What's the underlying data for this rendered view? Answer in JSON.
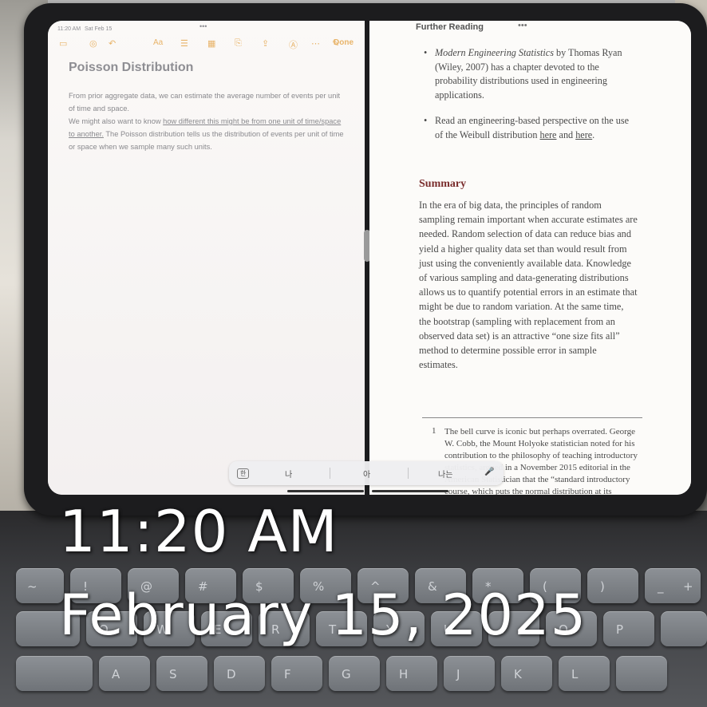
{
  "status_bar": {
    "time": "11:20 AM",
    "date": "Sat Feb 15"
  },
  "notes": {
    "done_label": "Done",
    "title": "Poisson Distribution",
    "line1": "From prior aggregate data, we can estimate the average number of events per unit of time and space.",
    "line2_prefix": "We might also want to know ",
    "line2_link": "how different this might be from one unit of time/space to another.",
    "line2_suffix": " The Poisson distribution tells us the distribution of events per unit of time or space when we sample many such units."
  },
  "reader": {
    "section_header": "Further Reading",
    "more_dots": "•••",
    "bullet1_title": "Modern Engineering Statistics",
    "bullet1_rest": " by Thomas Ryan (Wiley, 2007) has a chapter devoted to the probability distributions used in engineering applications.",
    "bullet2_prefix": "Read an engineering-based perspective on the use of the Weibull distribution ",
    "bullet2_link1": "here",
    "bullet2_and": " and ",
    "bullet2_link2": "here",
    "bullet2_end": ".",
    "summary_heading": "Summary",
    "summary_text": "In the era of big data, the principles of random sampling remain important when accurate estimates are needed. Random selection of data can reduce bias and yield a higher quality data set than would result from just using the conveniently available data. Knowledge of various sampling and data-generating distributions allows us to quantify potential errors in an estimate that might be due to random variation. At the same time, the bootstrap (sampling with replacement from an observed data set) is an attractive “one size fits all” method to determine possible error in sample estimates.",
    "footnote_number": "1",
    "footnote_text": "The bell curve is iconic but perhaps overrated. George W. Cobb, the Mount Holyoke statistician noted for his contribution to the philosophy of teaching introductory statistics, argued in a November 2015 editorial in the American Statistician that the “standard introductory course, which puts the normal distribution at its"
  },
  "keyboard_bar": {
    "lang": "한",
    "s1": "나",
    "s2": "아",
    "s3": "나는",
    "mic": "🎤"
  },
  "keys_row1": [
    "~",
    "!",
    "@",
    "#",
    "$",
    "%",
    "^",
    "&",
    "*",
    "(",
    ")",
    "_",
    "+"
  ],
  "keys_row2": [
    "Q",
    "W",
    "E",
    "R",
    "T",
    "Y",
    "U",
    "I",
    "O",
    "P"
  ],
  "keys_row3": [
    "A",
    "S",
    "D",
    "F",
    "G",
    "H",
    "J",
    "K",
    "L"
  ],
  "overlay": {
    "time": "11:20 AM",
    "date": "February 15, 2025"
  }
}
